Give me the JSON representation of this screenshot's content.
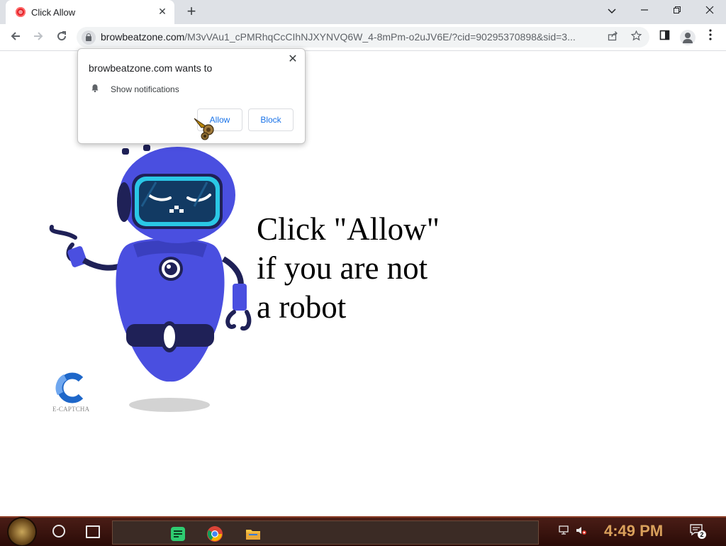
{
  "browser": {
    "tab": {
      "title": "Click Allow",
      "close_glyph": "✕"
    },
    "new_tab_glyph": "+",
    "window_controls": {
      "dropdown": "⌄",
      "minimize": "—",
      "restore": "❐",
      "close": "✕"
    },
    "toolbar": {
      "back": "←",
      "forward": "→",
      "reload": "↻",
      "url_host": "browbeatzone.com",
      "url_path": "/M3vVAu1_cPMRhqCcCIhNJXYNVQ6W_4-8mPm-o2uJV6E/?cid=90295370898&sid=3...",
      "share_glyph": "⇪",
      "bookmark_glyph": "☆",
      "sidepanel_glyph": "▢",
      "menu_glyph": "⋮"
    }
  },
  "popup": {
    "heading": "browbeatzone.com wants to",
    "permission": "Show notifications",
    "close_glyph": "✕",
    "allow_label": "Allow",
    "block_label": "Block"
  },
  "page": {
    "headline_lines": [
      "Click \"Allow\"",
      "if you are not",
      "a robot"
    ],
    "captcha_label": "E-CAPTCHA"
  },
  "taskbar": {
    "clock": "4:49 PM",
    "notification_count": "2"
  },
  "colors": {
    "robot_blue": "#4a4fe0",
    "robot_dark": "#1f2157",
    "visor": "#2ac7e6",
    "link_blue": "#1a73e8",
    "taskbar_clock": "#d9a05b"
  }
}
